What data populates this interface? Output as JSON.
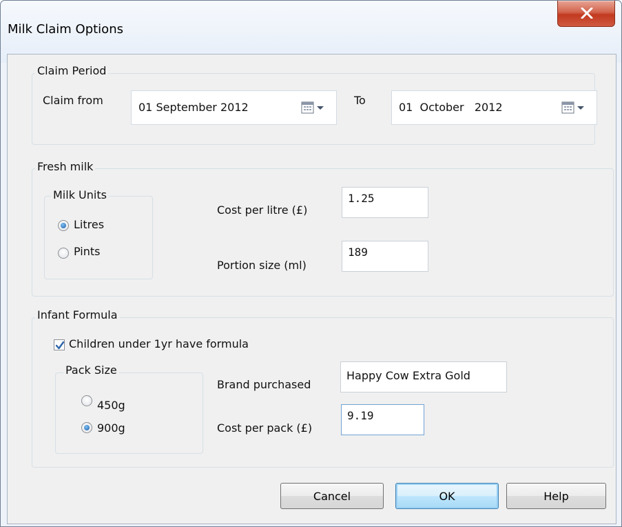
{
  "window": {
    "title": "Milk Claim Options"
  },
  "claim_period": {
    "legend": "Claim Period",
    "from_label": "Claim from",
    "from_value": "01 September 2012",
    "to_label": "To",
    "to_value": "01  October   2012"
  },
  "fresh_milk": {
    "legend": "Fresh milk",
    "units_legend": "Milk Units",
    "units_options": [
      "Litres",
      "Pints"
    ],
    "units_selected": "Litres",
    "cost_label": "Cost per litre (£)",
    "cost_value": "1.25",
    "portion_label": "Portion size (ml)",
    "portion_value": "189"
  },
  "infant_formula": {
    "legend": "Infant Formula",
    "checkbox_label": "Children under 1yr have formula",
    "checkbox_checked": true,
    "pack_legend": "Pack Size",
    "pack_options": [
      "450g",
      "900g"
    ],
    "pack_selected": "900g",
    "brand_label": "Brand purchased",
    "brand_value": "Happy Cow Extra Gold",
    "pack_cost_label": "Cost per pack (£)",
    "pack_cost_value": "9.19"
  },
  "buttons": {
    "cancel": "Cancel",
    "ok": "OK",
    "help": "Help"
  }
}
